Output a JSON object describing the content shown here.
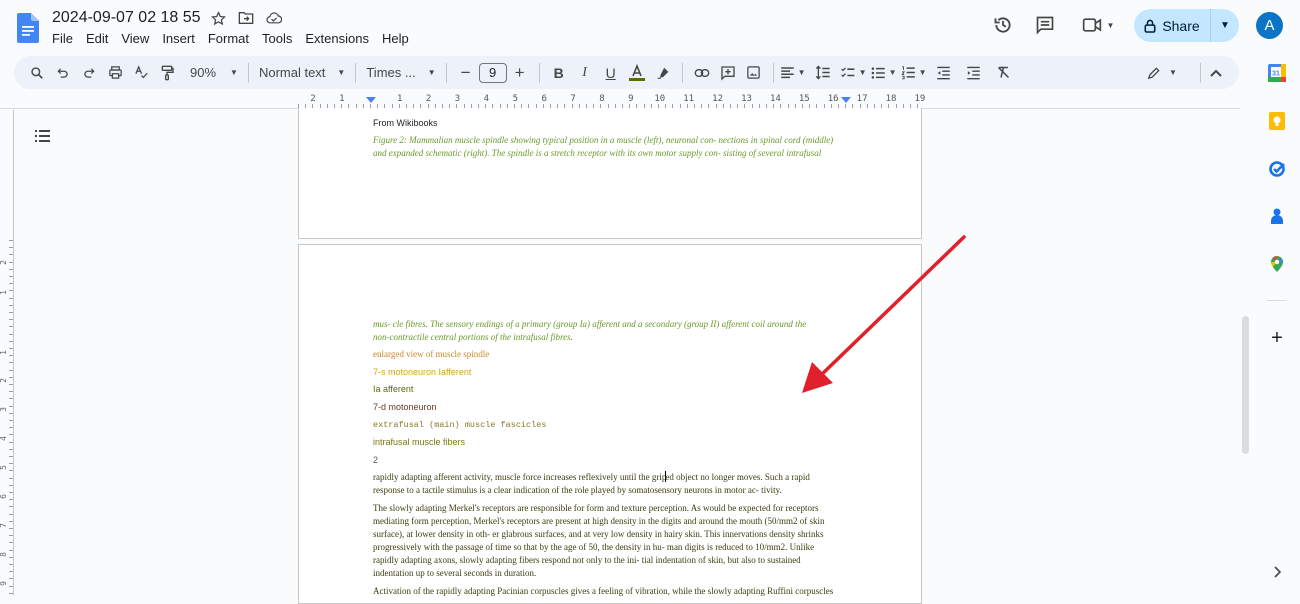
{
  "document": {
    "title": "2024-09-07 02 18 55"
  },
  "menu": {
    "items": [
      "File",
      "Edit",
      "View",
      "Insert",
      "Format",
      "Tools",
      "Extensions",
      "Help"
    ]
  },
  "header_actions": {
    "share_label": "Share",
    "avatar_initial": "A"
  },
  "toolbar": {
    "zoom": "90%",
    "style": "Normal text",
    "font": "Times ...",
    "font_size": "9",
    "text_color": "#5b6b00"
  },
  "ruler": {
    "horizontal_labels": [
      "2",
      "1",
      "1",
      "2",
      "3",
      "4",
      "5",
      "6",
      "7",
      "8",
      "9",
      "10",
      "11",
      "12",
      "13",
      "14",
      "15",
      "16",
      "17",
      "18",
      "19"
    ],
    "vertical_labels": [
      "2",
      "1",
      "1",
      "2",
      "3",
      "4",
      "5",
      "6",
      "7",
      "8",
      "9"
    ]
  },
  "page1": {
    "source": "From Wikibooks",
    "caption_line1": "Figure 2: Mammalian muscle spindle showing typical position in a muscle (left), neuronal con- nections in spinal cord (middle)",
    "caption_line2": "and expanded schematic (right). The spindle is a stretch receptor with its own motor supply con- sisting of several intrafusal"
  },
  "page2": {
    "caption_line3": "mus- cle fibres. The sensory endings of a primary (group Ia) afferent and a secondary (group II) afferent coil around the",
    "caption_line4": "non-contractile central portions of the intrafusal fibres.",
    "labels": [
      {
        "text": "enlarged view of muscle spindle",
        "color": "#c98a2a"
      },
      {
        "text": "7-s motoneuron Iafferent",
        "color": "#d4a514"
      },
      {
        "text": "Ia afferent",
        "color": "#5b6b00"
      },
      {
        "text": "7-d motoneuron",
        "color": "#6b3a20"
      },
      {
        "text": "extrafusal (main) muscle fascicles",
        "color": "#8a7a22"
      },
      {
        "text": "intrafusal muscle fibers",
        "color": "#7a7a10"
      },
      {
        "text": "2",
        "color": "#555555"
      }
    ],
    "para1_line1_a": "rapidly adapting afferent activity, muscle force increases reflexively until the grip",
    "para1_line1_b": "ed object no longer moves. Such a rapid",
    "para1_line2": "response to a tactile stimulus is a clear indication of the role played by somatosensory neurons in motor ac- tivity.",
    "para2_lines": [
      "The slowly adapting Merkel's receptors are responsible for form and texture perception. As would be expected for receptors",
      "mediating form perception, Merkel's receptors are present at high density in the digits and around the mouth (50/mm2 of skin",
      "surface), at lower density in oth- er glabrous surfaces, and at very low density in hairy skin. This innervations density shrinks",
      "progressively with the passage of time so that by the age of 50, the density in hu- man digits is reduced to 10/mm2. Unlike",
      "rapidly adapting axons, slowly adapting fibers respond not only to the ini- tial indentation of skin, but also to sustained",
      "indentation up to several seconds in duration."
    ],
    "para3_line1": "Activation of the rapidly adapting Pacinian corpuscles gives a feeling of vibration, while the slowly adapting Ruffini corpuscles"
  },
  "colors": {
    "caption_green": "#6a9a2a",
    "body_text": "#3d3d10",
    "annotation_arrow": "#e0202a",
    "share_bg": "#c2e7ff",
    "avatar_bg": "#0b74c4"
  }
}
